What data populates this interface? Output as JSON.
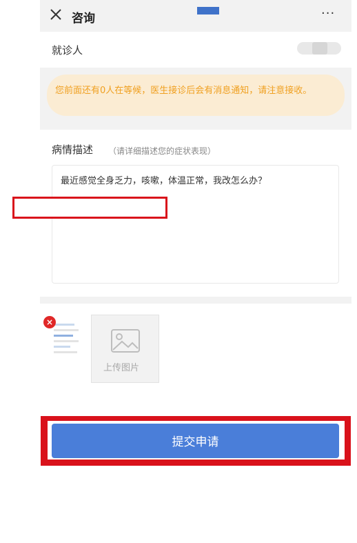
{
  "header": {
    "title": "咨询",
    "more_label": "···"
  },
  "patient": {
    "label": "就诊人"
  },
  "notice": {
    "text": "您前面还有0人在等候，医生接诊后会有消息通知，请注意接收。"
  },
  "description": {
    "label": "病情描述",
    "hint": "（请详细描述您的症状表现）",
    "value": "最近感觉全身乏力，咳嗽，体温正常，我改怎么办？"
  },
  "upload": {
    "label": "上传图片",
    "delete_symbol": "×"
  },
  "submit": {
    "label": "提交申请"
  },
  "colors": {
    "accent": "#4a7ed9",
    "highlight": "#d9121b",
    "notice_text": "#f0a020",
    "notice_bg": "#fbecd3"
  }
}
